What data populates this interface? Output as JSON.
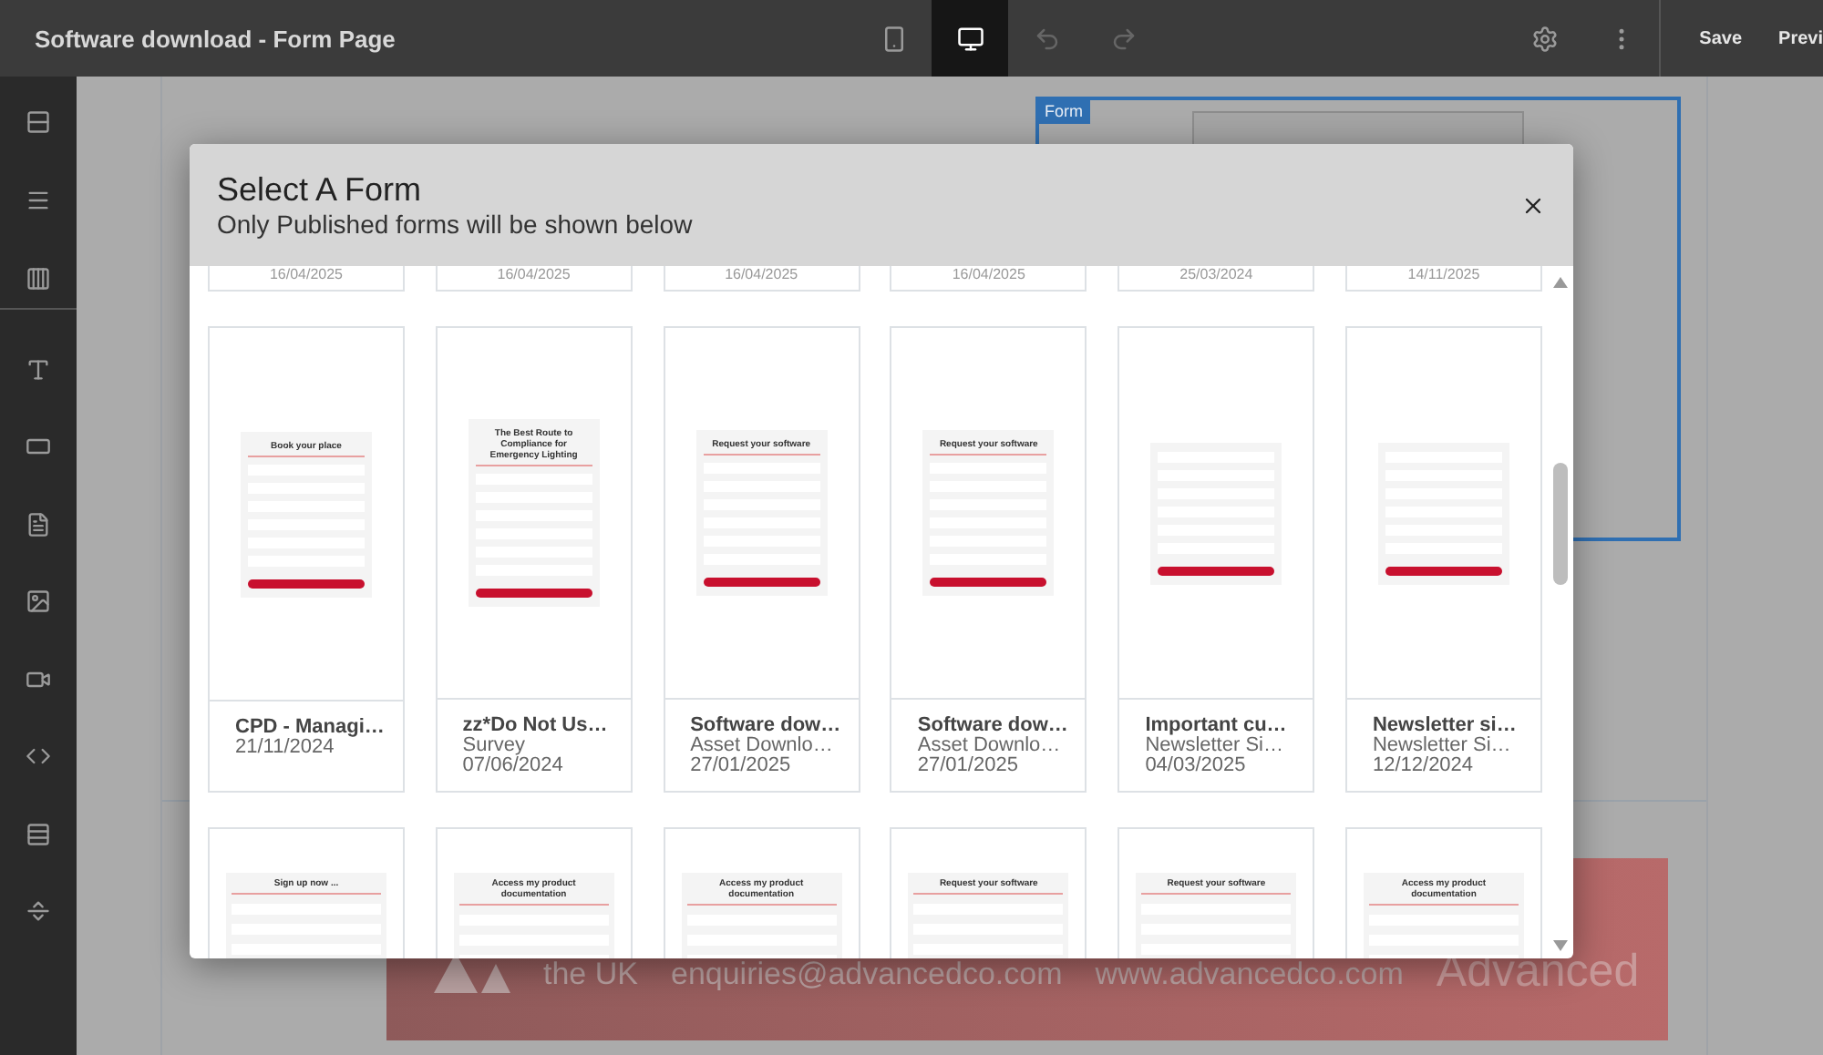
{
  "topbar": {
    "title": "Software download - Form Page",
    "devices": [
      {
        "kind": "mobile",
        "selected": false
      },
      {
        "kind": "desktop",
        "selected": true
      }
    ],
    "save": "Save",
    "preview": "Previ"
  },
  "sidebar": {
    "groups": [
      [
        {
          "kind": "sections"
        },
        {
          "kind": "rows"
        },
        {
          "kind": "columns"
        }
      ],
      [
        {
          "kind": "text"
        },
        {
          "kind": "button"
        },
        {
          "kind": "form"
        },
        {
          "kind": "image"
        },
        {
          "kind": "video"
        },
        {
          "kind": "code"
        },
        {
          "kind": "divider"
        },
        {
          "kind": "spacer"
        }
      ]
    ]
  },
  "form_widget": {
    "label": "Form"
  },
  "footer": {
    "texts": [
      "the UK",
      "enquiries@advancedco.com",
      "www.advancedco.com"
    ],
    "logo": "Advanced"
  },
  "modal": {
    "title": "Select A Form",
    "subtitle": "Only Published forms will be shown below",
    "top_row": [
      "16/04/2025",
      "16/04/2025",
      "16/04/2025",
      "16/04/2025",
      "25/03/2024",
      "14/11/2025"
    ],
    "cards": [
      {
        "title": "CPD - Managi…",
        "subtitle": "21/11/2024",
        "preview": {
          "heading": "Book your place"
        }
      },
      {
        "title": "zz*Do Not Us…",
        "subtitle": "Survey",
        "date": "07/06/2024",
        "preview": {
          "heading": "The Best Route to Compliance for Emergency Lighting"
        }
      },
      {
        "title": "Software dow…",
        "subtitle": "Asset Downlo…",
        "date": "27/01/2025",
        "preview": {
          "heading": "Request your software"
        }
      },
      {
        "title": "Software dow…",
        "subtitle": "Asset Downlo…",
        "date": "27/01/2025",
        "preview": {
          "heading": "Request your software"
        }
      },
      {
        "title": "Important cu…",
        "subtitle": "Newsletter Si…",
        "date": "04/03/2025"
      },
      {
        "title": "Newsletter si…",
        "subtitle": "Newsletter Si…",
        "date": "12/12/2024"
      }
    ],
    "bottom_row": [
      "Sign up now ...",
      "Access my product documentation",
      "Access my product documentation",
      "Request your software",
      "Request your software",
      "Access my product documentation"
    ]
  }
}
